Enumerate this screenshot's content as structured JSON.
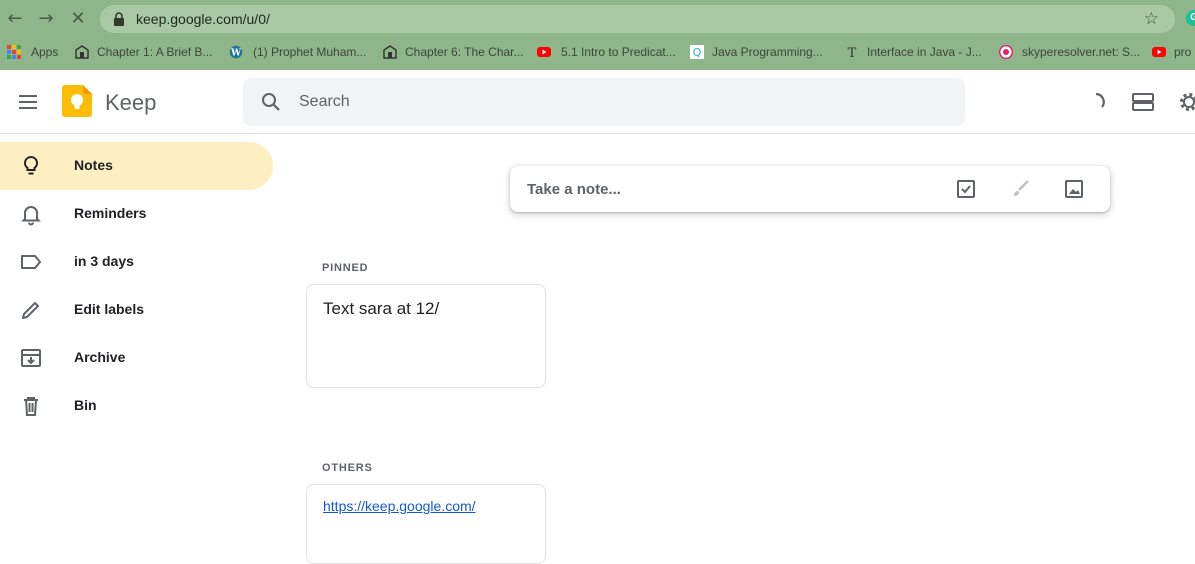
{
  "browser": {
    "url": "keep.google.com/u/0/",
    "bookmarks": [
      {
        "label": "Apps",
        "icon": "apps-grid-icon",
        "color": "#f4b400"
      },
      {
        "label": "Chapter 1: A Brief B...",
        "icon": "archive-site-icon",
        "color": "#333333"
      },
      {
        "label": "(1) Prophet Muham...",
        "icon": "wordpress-icon",
        "color": "#21759b"
      },
      {
        "label": "Chapter 6: The Char...",
        "icon": "archive-site-icon",
        "color": "#333333"
      },
      {
        "label": "5.1 Intro to Predicat...",
        "icon": "youtube-icon",
        "color": "#ff0000"
      },
      {
        "label": "Java Programming...",
        "icon": "q-site-icon",
        "color": "#1bb6c9"
      },
      {
        "label": "Interface in Java - J...",
        "icon": "t-site-icon",
        "color": "#333333"
      },
      {
        "label": "skyperesolver.net: S...",
        "icon": "skype-resolver-icon",
        "color": "#e91e63"
      },
      {
        "label": "pro",
        "icon": "youtube-icon",
        "color": "#ff0000"
      }
    ]
  },
  "header": {
    "brand": "Keep",
    "search_placeholder": "Search"
  },
  "sidebar": {
    "items": [
      {
        "label": "Notes",
        "icon": "lightbulb-icon",
        "active": true
      },
      {
        "label": "Reminders",
        "icon": "bell-icon",
        "active": false
      },
      {
        "label": "in 3 days",
        "icon": "label-icon",
        "active": false
      },
      {
        "label": "Edit labels",
        "icon": "pencil-icon",
        "active": false
      },
      {
        "label": "Archive",
        "icon": "archive-icon",
        "active": false
      },
      {
        "label": "Bin",
        "icon": "trash-icon",
        "active": false
      }
    ]
  },
  "main": {
    "take_note_placeholder": "Take a note...",
    "pinned_label": "PINNED",
    "others_label": "OTHERS",
    "pinned_note": "Text sara at 12/",
    "other_note_link": "https://keep.google.com/"
  },
  "colors": {
    "accent": "#feefc3",
    "chrome": "#8fb58a",
    "logo": "#fbbc04"
  }
}
